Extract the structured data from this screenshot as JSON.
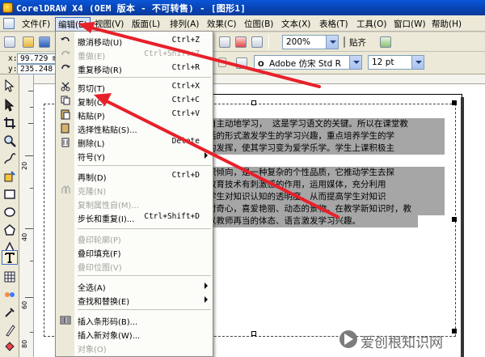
{
  "window": {
    "title": "CorelDRAW X4 (OEM 版本 - 不可转售) - [图形1]"
  },
  "menubar": {
    "items": [
      {
        "label": "文件(F)"
      },
      {
        "label": "编辑(E)"
      },
      {
        "label": "视图(V)"
      },
      {
        "label": "版面(L)"
      },
      {
        "label": "排列(A)"
      },
      {
        "label": "效果(C)"
      },
      {
        "label": "位图(B)"
      },
      {
        "label": "文本(X)"
      },
      {
        "label": "表格(T)"
      },
      {
        "label": "工具(O)"
      },
      {
        "label": "窗口(W)"
      },
      {
        "label": "帮助(H)"
      }
    ]
  },
  "toolbar": {
    "zoom": "200%",
    "snap_label": "贴齐",
    "font_name": "Adobe 仿宋 Std R",
    "font_size": "12 pt",
    "x_label": "x:",
    "y_label": "y:",
    "x_value": "99.729 mm",
    "y_value": "235.248 mm"
  },
  "edit_menu": {
    "items": [
      {
        "label": "撤消移动(U)",
        "shortcut": "Ctrl+Z",
        "disabled": false
      },
      {
        "label": "重做(E)",
        "shortcut": "Ctrl+Shift+Z",
        "disabled": true
      },
      {
        "label": "重复移动(R)",
        "shortcut": "Ctrl+R",
        "disabled": false
      },
      {
        "label": "剪切(T)",
        "shortcut": "Ctrl+X",
        "disabled": false
      },
      {
        "label": "复制(C)",
        "shortcut": "Ctrl+C",
        "disabled": false
      },
      {
        "label": "粘贴(P)",
        "shortcut": "Ctrl+V",
        "disabled": false
      },
      {
        "label": "选择性粘贴(S)...",
        "shortcut": "",
        "disabled": false
      },
      {
        "label": "删除(L)",
        "shortcut": "Delete",
        "disabled": false
      },
      {
        "label": "符号(Y)",
        "shortcut": "",
        "disabled": false
      },
      {
        "label": "再制(D)",
        "shortcut": "Ctrl+D",
        "disabled": false
      },
      {
        "label": "克隆(N)",
        "shortcut": "",
        "disabled": true
      },
      {
        "label": "复制属性自(M)...",
        "shortcut": "",
        "disabled": true
      },
      {
        "label": "步长和重复(I)...",
        "shortcut": "Ctrl+Shift+D",
        "disabled": false
      },
      {
        "label": "叠印轮廓(P)",
        "shortcut": "",
        "disabled": true
      },
      {
        "label": "叠印填充(F)",
        "shortcut": "",
        "disabled": false
      },
      {
        "label": "叠印位图(V)",
        "shortcut": "",
        "disabled": true
      },
      {
        "label": "全选(A)",
        "shortcut": "",
        "disabled": false
      },
      {
        "label": "查找和替换(E)",
        "shortcut": "",
        "disabled": false
      },
      {
        "label": "插入条形码(B)...",
        "shortcut": "",
        "disabled": false
      },
      {
        "label": "插入新对象(W)...",
        "shortcut": "",
        "disabled": false
      },
      {
        "label": "对象(O)",
        "shortcut": "",
        "disabled": true
      }
    ]
  },
  "document_text": {
    "lines": [
      "自主动地学习， 这是学习语文的关键。所以在课堂教",
      "话的形式激发学生的学习兴趣，重点培养学生的学",
      "的发挥，使其学习变为爱学乐学。学生上课积极主",
      "",
      "识倾向，是一种复杂的个性品质，它推动学生去探",
      "教育技术有刺激感的作用，运用媒体，充分利用",
      "学生对知识认知的透明度，从而提高学生对知识",
      "对奇心，喜爱艳丽、动态的景物。在教学新知识时，教",
      "以教师再当的体态、语言激发学习兴趣。"
    ]
  },
  "ruler": {
    "v_labels": [
      "20",
      "40",
      "60",
      "80",
      "100"
    ]
  },
  "watermark": {
    "text": "爱创根知识网"
  },
  "colors": {
    "annotation_red": "#e8202a",
    "selection_blue": "#3167c6",
    "title_blue": "#0a55d8"
  }
}
